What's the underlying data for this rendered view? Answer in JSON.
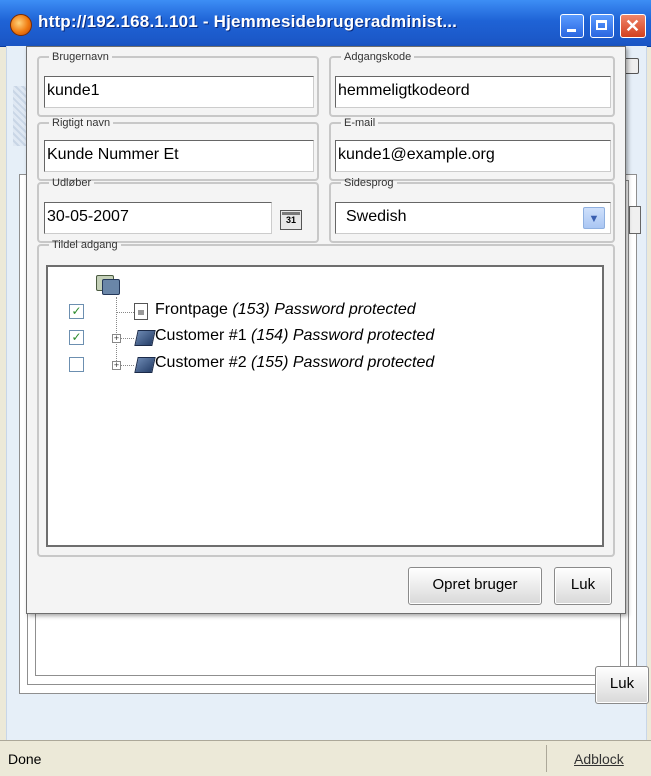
{
  "window": {
    "title": "http://192.168.1.101 - Hjemmesidebrugeradminist...",
    "minimize_icon": "minimize-icon",
    "maximize_icon": "maximize-icon",
    "close_icon": "close-icon"
  },
  "background_page": {
    "close_label": "Luk"
  },
  "dialog": {
    "username": {
      "legend": "Brugernavn",
      "value": "kunde1"
    },
    "password": {
      "legend": "Adgangskode",
      "value": "hemmeligtkodeord"
    },
    "realname": {
      "legend": "Rigtigt navn",
      "value": "Kunde Nummer Et"
    },
    "email": {
      "legend": "E-mail",
      "value": "kunde1@example.org"
    },
    "expires": {
      "legend": "Udløber",
      "value": "30-05-2007",
      "calendar_label": "31"
    },
    "language": {
      "legend": "Sidesprog",
      "value": "Swedish"
    },
    "access": {
      "legend": "Tildel adgang",
      "items": [
        {
          "checked": true,
          "name": "Frontpage",
          "id_text": "(153)",
          "status": "Password protected",
          "icon": "page-icon"
        },
        {
          "checked": true,
          "name": "Customer #1",
          "id_text": "(154)",
          "status": "Password protected",
          "icon": "book-icon"
        },
        {
          "checked": false,
          "name": "Customer #2",
          "id_text": "(155)",
          "status": "Password protected",
          "icon": "book-icon"
        }
      ]
    },
    "create_button": "Opret bruger",
    "close_button": "Luk"
  },
  "statusbar": {
    "status": "Done",
    "addon": "Adblock"
  }
}
